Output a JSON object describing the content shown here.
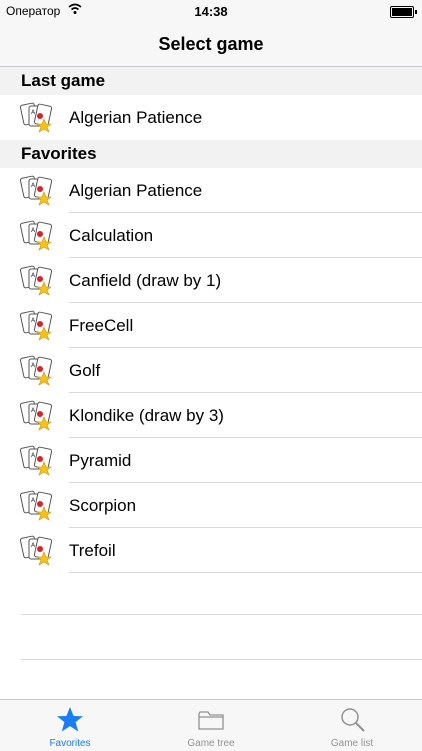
{
  "status": {
    "carrier": "Оператор",
    "time": "14:38"
  },
  "nav": {
    "title": "Select game"
  },
  "sections": [
    {
      "header": "Last game",
      "items": [
        "Algerian Patience"
      ]
    },
    {
      "header": "Favorites",
      "items": [
        "Algerian Patience",
        "Calculation",
        "Canfield (draw by 1)",
        "FreeCell",
        "Golf",
        "Klondike (draw by 3)",
        "Pyramid",
        "Scorpion",
        "Trefoil"
      ]
    }
  ],
  "tabs": [
    {
      "label": "Favorites",
      "icon": "star-icon",
      "active": true
    },
    {
      "label": "Game tree",
      "icon": "folder-icon",
      "active": false
    },
    {
      "label": "Game list",
      "icon": "search-icon",
      "active": false
    }
  ],
  "colors": {
    "accent": "#1a7ef2",
    "inactive": "#929292",
    "header_bg": "#f2f2f2",
    "bar_bg": "#f7f7f7"
  }
}
